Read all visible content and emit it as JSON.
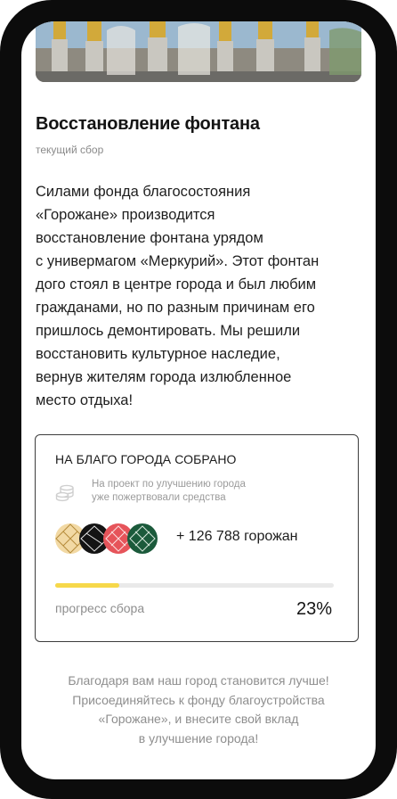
{
  "campaign": {
    "title": "Восстановление фонтана",
    "subtitle": "текущий сбор",
    "description_lines": [
      "Силами фонда благосостояния",
      "«Горожане» производится",
      "восстановление фонтана урядом",
      "с универмагом «Меркурий». Этот фонтан",
      "дого стоял в центре города и был любим",
      "гражданами, но по разным причинам его",
      "пришлось демонтировать. Мы решили",
      "восстановить культурное наследие,",
      "вернув жителям города излюбленное",
      "место отдыха!"
    ]
  },
  "stats_card": {
    "title": "НА БЛАГО ГОРОДА СОБРАНО",
    "note_lines": [
      "На проект по улучшению города",
      "уже пожертвовали средства"
    ],
    "donors_count": "+ 126 788 горожан",
    "progress_label": "прогресс сбора",
    "progress_percent": "23%",
    "progress_value": 0.23,
    "icons": [
      "coins-icon"
    ],
    "avatar_colors": [
      "#f2d9a4",
      "#141414",
      "#e6545a",
      "#1b5a3b"
    ],
    "accent_color": "#f6d84a"
  },
  "footer": {
    "lines": [
      "Благодаря вам наш город становится лучше!",
      "Присоединяйтесь к фонду благоустройства",
      "«Горожане», и внесите свой вклад",
      "в улучшение города!"
    ]
  }
}
